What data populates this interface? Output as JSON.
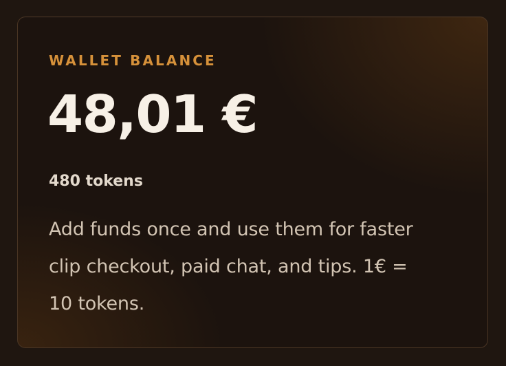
{
  "wallet": {
    "eyebrow": "WALLET BALANCE",
    "amount": "48,01 €",
    "tokens": "480 tokens",
    "description": "Add funds once and use them for faster clip checkout, paid chat, and tips. 1€ = 10 tokens."
  },
  "colors": {
    "page_background": "#1f1610",
    "card_background": "#1c130e",
    "card_border": "#4a3524",
    "accent": "#d6913a",
    "amount_text": "#f7f0e6",
    "tokens_text": "#e3d9cc",
    "description_text": "#d2c4b3"
  }
}
